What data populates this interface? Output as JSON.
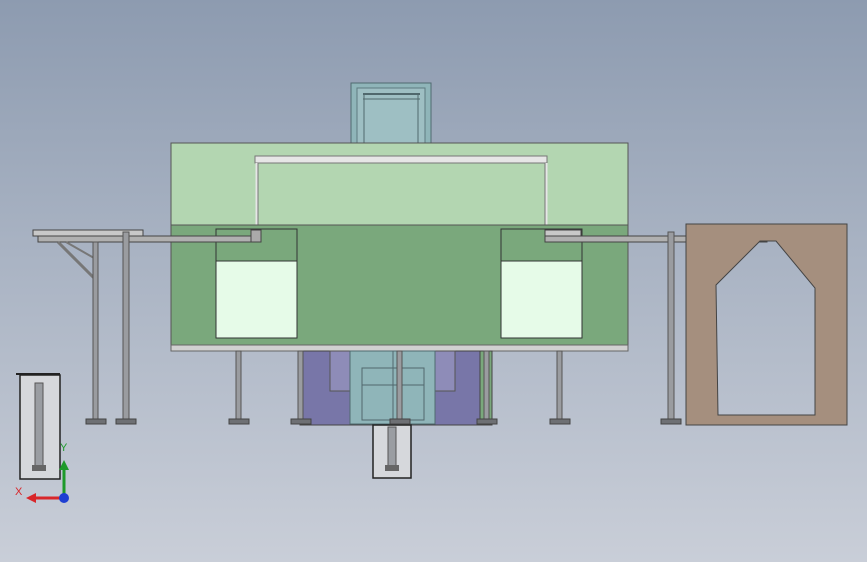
{
  "viewport": {
    "background_top": "#8d9bb0",
    "background_bottom": "#c9ced8"
  },
  "model_colors": {
    "upper_panel": "#b3d6b1",
    "lower_panel": "#7aa87c",
    "window": "#e6fbe8",
    "tower_glass": "#8fb5b9",
    "base_purple": "#7876a8",
    "right_frame": "#a58f7e",
    "steel": "#8c8e92"
  },
  "triad": {
    "x_label": "X",
    "y_label": "Y",
    "x_color": "#d8262a",
    "y_color": "#1d9a2a",
    "z_color": "#1e3fd2"
  }
}
